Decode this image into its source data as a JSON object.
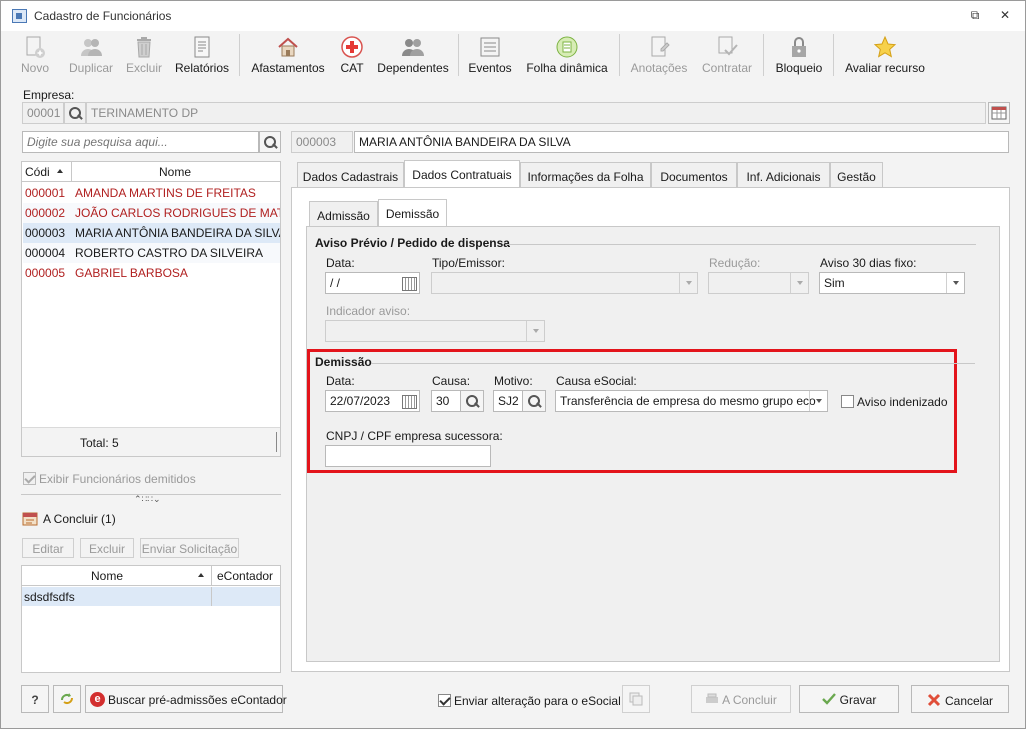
{
  "window": {
    "title": "Cadastro de Funcionários",
    "restore_glyph": "⧉",
    "close_glyph": "✕"
  },
  "toolbar": {
    "items": [
      {
        "label": "Novo",
        "icon": "new-document-icon",
        "enabled": false
      },
      {
        "label": "Duplicar",
        "icon": "duplicate-users-icon",
        "enabled": false
      },
      {
        "label": "Excluir",
        "icon": "trash-icon",
        "enabled": false
      },
      {
        "label": "Relatórios",
        "icon": "report-icon",
        "enabled": true
      },
      {
        "label": "Afastamentos",
        "icon": "house-icon",
        "enabled": true
      },
      {
        "label": "CAT",
        "icon": "red-cross-icon",
        "enabled": true
      },
      {
        "label": "Dependentes",
        "icon": "people-icon",
        "enabled": true
      },
      {
        "label": "Eventos",
        "icon": "list-icon",
        "enabled": true
      },
      {
        "label": "Folha dinâmica",
        "icon": "dynamic-sheet-icon",
        "enabled": true
      },
      {
        "label": "Anotações",
        "icon": "notes-icon",
        "enabled": false
      },
      {
        "label": "Contratar",
        "icon": "hire-icon",
        "enabled": false
      },
      {
        "label": "Bloqueio",
        "icon": "lock-icon",
        "enabled": true
      },
      {
        "label": "Avaliar recurso",
        "icon": "star-icon",
        "enabled": true
      }
    ]
  },
  "empresa": {
    "label": "Empresa:",
    "code": "00001",
    "name": "TERINAMENTO DP"
  },
  "search": {
    "placeholder": "Digite sua pesquisa aqui..."
  },
  "employee_header": {
    "code": "000003",
    "name": "MARIA ANTÔNIA BANDEIRA DA SILVA"
  },
  "employee_list": {
    "col_code": "Códi",
    "col_name": "Nome",
    "rows": [
      {
        "code": "000001",
        "name": "AMANDA MARTINS DE FREITAS",
        "color": "#b01f1f"
      },
      {
        "code": "000002",
        "name": "JOÃO CARLOS RODRIGUES DE MATTOS",
        "color": "#b01f1f"
      },
      {
        "code": "000003",
        "name": "MARIA ANTÔNIA BANDEIRA DA SILVA",
        "color": "#1a1a1a"
      },
      {
        "code": "000004",
        "name": "ROBERTO CASTRO DA SILVEIRA",
        "color": "#1a1a1a"
      },
      {
        "code": "000005",
        "name": "GABRIEL BARBOSA",
        "color": "#b01f1f"
      }
    ],
    "total": "Total: 5"
  },
  "show_dismissed": {
    "label": "Exibir Funcionários demitidos",
    "checked": true
  },
  "a_concluir": {
    "title": "A Concluir (1)",
    "buttons": [
      "Editar",
      "Excluir",
      "Enviar Solicitação"
    ],
    "col_name": "Nome",
    "col_econtador": "eContador",
    "rows": [
      {
        "name": "sdsdfsdfs",
        "econtador": ""
      }
    ]
  },
  "tabs": [
    "Dados Cadastrais",
    "Dados Contratuais",
    "Informações da Folha",
    "Documentos",
    "Inf. Adicionais",
    "Gestão"
  ],
  "subtabs": [
    "Admissão",
    "Demissão"
  ],
  "aviso_previo": {
    "title": "Aviso Prévio / Pedido de dispensa",
    "data_label": "Data:",
    "data_value": " /  /",
    "tipo_label": "Tipo/Emissor:",
    "reducao_label": "Redução:",
    "aviso30_label": "Aviso 30 dias fixo:",
    "aviso30_value": "Sim",
    "indicador_label": "Indicador aviso:"
  },
  "demissao": {
    "title": "Demissão",
    "data_label": "Data:",
    "data_value": "22/07/2023",
    "causa_label": "Causa:",
    "causa_value": "30",
    "motivo_label": "Motivo:",
    "motivo_value": "SJ2",
    "causa_esocial_label": "Causa eSocial:",
    "causa_esocial_value": "Transferência de empresa do mesmo grupo eco",
    "aviso_indenizado_label": "Aviso indenizado",
    "cnpj_label": "CNPJ / CPF empresa sucessora:",
    "cnpj_value": "",
    "highlight_color": "#e3141b"
  },
  "footer": {
    "help_glyph": "?",
    "buscar_label": "Buscar pré-admissões eContador",
    "enviar_label": "Enviar alteração para o eSocial",
    "concluir_label": "A Concluir",
    "gravar_label": "Gravar",
    "cancelar_label": "Cancelar"
  }
}
